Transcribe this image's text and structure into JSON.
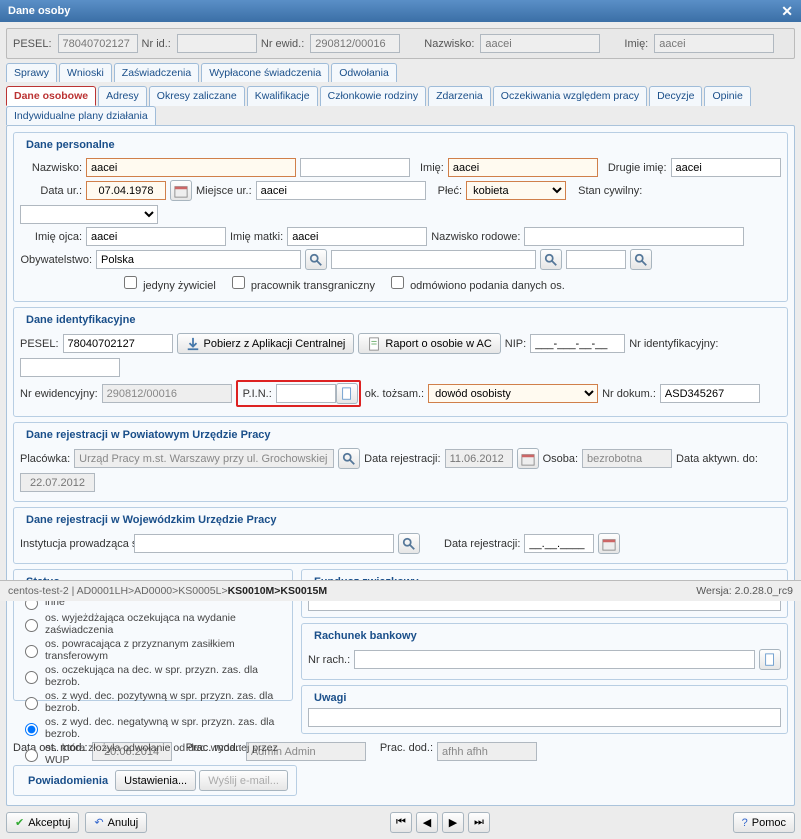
{
  "window": {
    "title": "Dane osoby"
  },
  "readbar": {
    "pesel_lbl": "PESEL:",
    "pesel": "78040702127",
    "nrid_lbl": "Nr id.:",
    "nrid": "",
    "nrewid_lbl": "Nr ewid.:",
    "nrewid": "290812/00016",
    "nazwisko_lbl": "Nazwisko:",
    "nazwisko": "aacei",
    "imie_lbl": "Imię:",
    "imie": "aacei"
  },
  "tabs": {
    "row1": [
      "Sprawy",
      "Wnioski",
      "Zaświadczenia",
      "Wypłacone świadczenia",
      "Odwołania"
    ],
    "row2": [
      "Dane osobowe",
      "Adresy",
      "Okresy zaliczane",
      "Kwalifikacje",
      "Członkowie rodziny",
      "Zdarzenia",
      "Oczekiwania względem pracy",
      "Decyzje",
      "Opinie",
      "Indywidualne plany działania"
    ],
    "active": "Dane osobowe"
  },
  "personal": {
    "title": "Dane personalne",
    "nazwisko_lbl": "Nazwisko:",
    "nazwisko": "aacei",
    "imie_lbl": "Imię:",
    "imie": "aacei",
    "drugie_lbl": "Drugie imię:",
    "drugie": "aacei",
    "dataur_lbl": "Data ur.:",
    "dataur": "07.04.1978",
    "miejsce_lbl": "Miejsce ur.:",
    "miejsce": "aacei",
    "plec_lbl": "Płeć:",
    "plec": "kobieta",
    "stanc_lbl": "Stan cywilny:",
    "imieojca_lbl": "Imię ojca:",
    "imieojca": "aacei",
    "imiematki_lbl": "Imię matki:",
    "imiematki": "aacei",
    "nazwrod_lbl": "Nazwisko rodowe:",
    "obyw_lbl": "Obywatelstwo:",
    "obyw": "Polska",
    "cb1": "jedyny żywiciel",
    "cb2": "pracownik transgraniczny",
    "cb3": "odmówiono podania danych os."
  },
  "ident": {
    "title": "Dane identyfikacyjne",
    "pesel_lbl": "PESEL:",
    "pesel": "78040702127",
    "btn_ac": "Pobierz z Aplikacji Centralnej",
    "btn_raport": "Raport o osobie w AC",
    "nip_lbl": "NIP:",
    "nip_mask": "___-___-__-__",
    "nrid_lbl": "Nr identyfikacyjny:",
    "nrewid_lbl": "Nr ewidencyjny:",
    "nrewid": "290812/00016",
    "pin_lbl": "P.I.N.:",
    "tozsam_lbl": "ok. tożsam.:",
    "tozsam": "dowód osobisty",
    "nrdok_lbl": "Nr dokum.:",
    "nrdok": "ASD345267"
  },
  "regpow": {
    "title": "Dane rejestracji w Powiatowym Urzędzie Pracy",
    "plac_lbl": "Placówka:",
    "plac": "Urząd Pracy m.st. Warszawy przy ul. Grochowskiej",
    "datarej_lbl": "Data rejestracji:",
    "datarej": "11.06.2012",
    "osoba_lbl": "Osoba:",
    "osoba": "bezrobotna",
    "datakt_lbl": "Data aktywn. do:",
    "datakt": "22.07.2012"
  },
  "regwoj": {
    "title": "Dane rejestracji w Wojewódzkim Urzędzie Pracy",
    "inst_lbl": "Instytucja prowadząca sprawę:",
    "datarej_lbl": "Data rejestracji:",
    "datarej_mask": "__.__.____"
  },
  "status": {
    "title": "Status",
    "opts": [
      "inne",
      "os. wyjeżdżająca oczekująca na wydanie zaświadczenia",
      "os. powracająca z przyznanym zasiłkiem transferowym",
      "os. oczekująca na dec. w spr. przyzn. zas. dla bezrob.",
      "os. z wyd. dec. pozytywną w spr. przyzn. zas. dla bezrob.",
      "os. z wyd. dec. negatywną w spr. przyzn. zas. dla bezrob.",
      "os. która złożyła odwołanie od dec. wydanej przez WUP"
    ],
    "selected_index": 5
  },
  "fund": {
    "title": "Fundusz związkowy"
  },
  "bank": {
    "title": "Rachunek bankowy",
    "nrrach_lbl": "Nr rach.:"
  },
  "uwagi": {
    "title": "Uwagi"
  },
  "pow": {
    "title": "Powiadomienia",
    "btn_ust": "Ustawienia...",
    "btn_mail": "Wyślij e-mail..."
  },
  "meta": {
    "dataost_lbl": "Data ost. mod.:",
    "dataost": "20.06.2014",
    "pracmod_lbl": "Prac. mod.:",
    "pracmod": "Admin Admin",
    "pracdod_lbl": "Prac. dod.:",
    "pracdod": "afhh afhh"
  },
  "buttons": {
    "accept": "Akceptuj",
    "cancel": "Anuluj",
    "help": "Pomoc"
  },
  "statusbar": {
    "path_prefix": "centos-test-2 | AD0001LH>AD0000>KS0005L>",
    "path_bold": "KS0010M>KS0015M",
    "version_lbl": "Wersja:",
    "version": "2.0.28.0_rc9"
  }
}
